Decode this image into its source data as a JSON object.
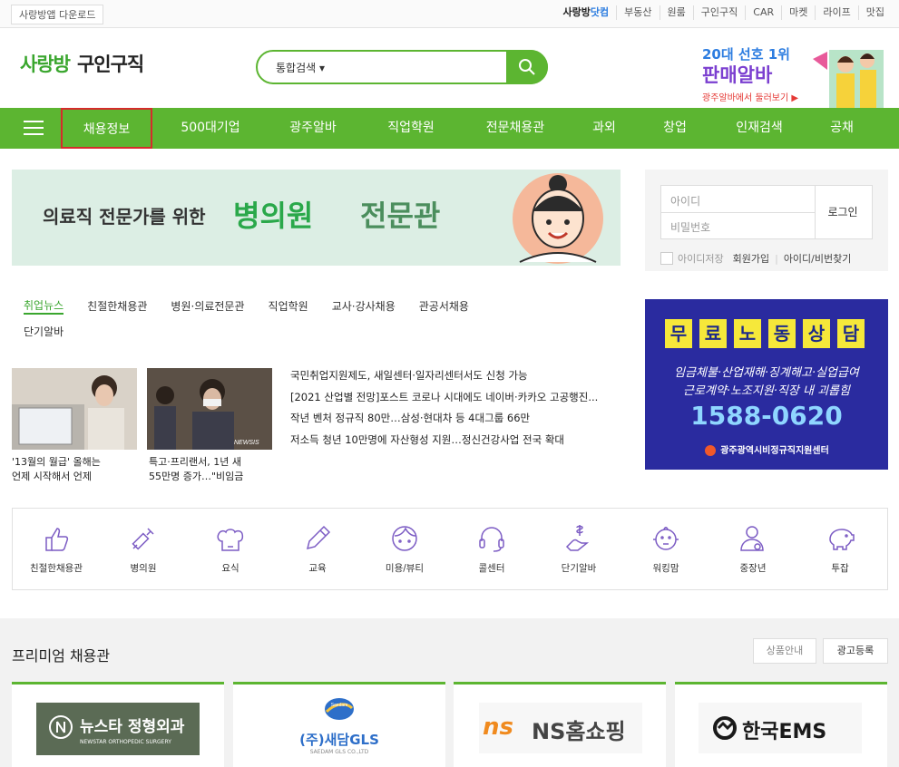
{
  "topbar": {
    "app_download": "사랑방앱 다운로드",
    "links": [
      "사랑방",
      "닷컴",
      "부동산",
      "원룸",
      "구인구직",
      "CAR",
      "마켓",
      "라이프",
      "맛집"
    ]
  },
  "header": {
    "brand": "사랑방",
    "section": "구인구직",
    "search_select": "통합검색 ▾",
    "promo_line1": "20대 선호 1위",
    "promo_line2": "판매알바",
    "promo_line3": "광주알바에서 둘러보기 ▶"
  },
  "gnb": {
    "items": [
      "채용정보",
      "500대기업",
      "광주알바",
      "직업학원",
      "전문채용관",
      "과외",
      "창업",
      "인재검색",
      "공채"
    ]
  },
  "banner": {
    "text": "의료직 전문가를 위한",
    "big1": "병의원",
    "big2": "전문관"
  },
  "login": {
    "id_placeholder": "아이디",
    "pw_placeholder": "비밀번호",
    "button": "로그인",
    "save_id": "아이디저장",
    "join": "회원가입",
    "find": "아이디/비번찾기"
  },
  "tabs": {
    "row1": [
      "취업뉴스",
      "친절한채용관",
      "병원·의료전문관",
      "직업학원",
      "교사·강사채용",
      "관공서채용"
    ],
    "row2": [
      "단기알바"
    ]
  },
  "news": {
    "captions": [
      [
        "'13월의 월급' 올해는",
        "언제 시작해서 언제"
      ],
      [
        "특고·프리랜서, 1년 새",
        "55만명 증가…\"비임금"
      ]
    ],
    "thumb2_tag": "NEWSIS",
    "list": [
      "국민취업지원제도, 새일센터·일자리센터서도 신청 가능",
      "[2021 산업별 전망]포스트 코로나 시대에도 네이버·카카오 고공행진...",
      "작년 벤처 정규직 80만…삼성·현대차 등 4대그룹 66만",
      "저소득 청년 10만명에 자산형성 지원…정신건강사업 전국 확대"
    ]
  },
  "labor": {
    "chars": [
      "무",
      "료",
      "노",
      "동",
      "상",
      "담"
    ],
    "line1": "임금체불·산업재해·징계해고·실업급여",
    "line2": "근로계약·노조지원·직장 내 괴롭힘",
    "phone": "1588-0620",
    "org": "광주광역시비정규직지원센터"
  },
  "categories": [
    "친절한채용관",
    "병의원",
    "요식",
    "교육",
    "미용/뷰티",
    "콜센터",
    "단기알바",
    "워킹맘",
    "중장년",
    "투잡"
  ],
  "premium": {
    "title": "프리미엄 채용관",
    "info_btn": "상품안내",
    "ad_btn": "광고등록",
    "cards": [
      "뉴스타 정형외과",
      "(주)새담GLS",
      "NS홈쇼핑",
      "한국EMS"
    ],
    "card1_sub": "NEWSTAR ORTHOPEDIC SURGERY",
    "card2_top": "Saedam",
    "card2_sub": "SAEDAM GLS CO.,LTD",
    "card3_mark": "ns"
  },
  "colors": {
    "accent_green": "#5cb531",
    "highlight_red": "#d62b2b",
    "labor_bg": "#2a2b9f"
  }
}
